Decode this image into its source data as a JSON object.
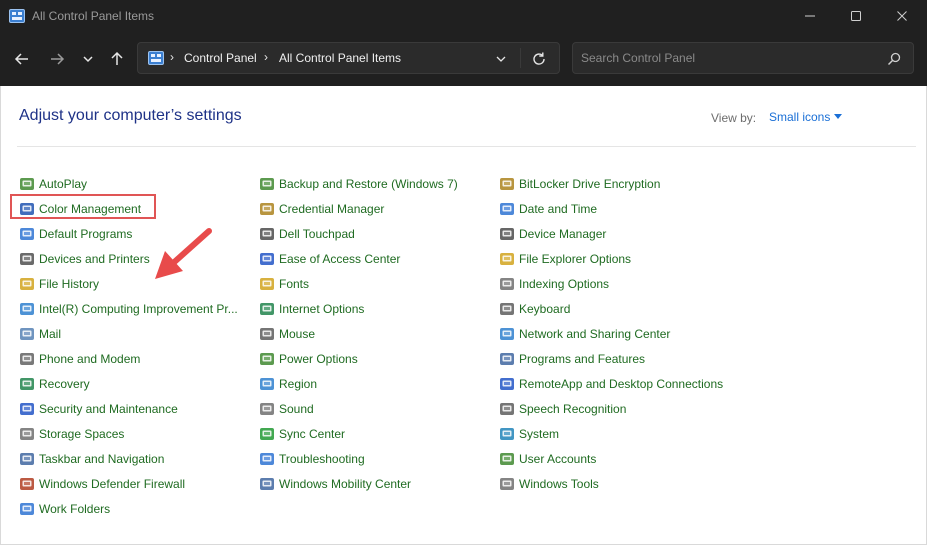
{
  "window": {
    "title": "All Control Panel Items"
  },
  "nav": {
    "breadcrumb": [
      "Control Panel",
      "All Control Panel Items"
    ],
    "search_placeholder": "Search Control Panel"
  },
  "main": {
    "heading": "Adjust your computer’s settings",
    "view_by_label": "View by:",
    "view_by_value": "Small icons"
  },
  "columns": [
    {
      "items": [
        {
          "label": "AutoPlay",
          "icon": "autoplay-icon",
          "color": "#4a8f3c"
        },
        {
          "label": "Color Management",
          "icon": "color-management-icon",
          "color": "#2c5db5"
        },
        {
          "label": "Default Programs",
          "icon": "default-programs-icon",
          "color": "#3a7bd5"
        },
        {
          "label": "Devices and Printers",
          "icon": "devices-printers-icon",
          "color": "#5a5a5a"
        },
        {
          "label": "File History",
          "icon": "file-history-icon",
          "color": "#d4a82a"
        },
        {
          "label": "Intel(R) Computing Improvement Pr...",
          "icon": "intel-icon",
          "color": "#3a86d0"
        },
        {
          "label": "Mail",
          "icon": "mail-icon",
          "color": "#5f88b8"
        },
        {
          "label": "Phone and Modem",
          "icon": "phone-modem-icon",
          "color": "#6a6a6a"
        },
        {
          "label": "Recovery",
          "icon": "recovery-icon",
          "color": "#2e8b57"
        },
        {
          "label": "Security and Maintenance",
          "icon": "flag-icon",
          "color": "#2f5ec9"
        },
        {
          "label": "Storage Spaces",
          "icon": "storage-spaces-icon",
          "color": "#777777"
        },
        {
          "label": "Taskbar and Navigation",
          "icon": "taskbar-icon",
          "color": "#4a6fa5"
        },
        {
          "label": "Windows Defender Firewall",
          "icon": "firewall-icon",
          "color": "#b5482f"
        },
        {
          "label": "Work Folders",
          "icon": "work-folders-icon",
          "color": "#3a7bd5"
        }
      ]
    },
    {
      "items": [
        {
          "label": "Backup and Restore (Windows 7)",
          "icon": "backup-restore-icon",
          "color": "#4a8f3c"
        },
        {
          "label": "Credential Manager",
          "icon": "credential-manager-icon",
          "color": "#b08a2a"
        },
        {
          "label": "Dell Touchpad",
          "icon": "touchpad-icon",
          "color": "#555555"
        },
        {
          "label": "Ease of Access Center",
          "icon": "ease-of-access-icon",
          "color": "#2f5ec9"
        },
        {
          "label": "Fonts",
          "icon": "fonts-icon",
          "color": "#d4a82a"
        },
        {
          "label": "Internet Options",
          "icon": "internet-options-icon",
          "color": "#2e8b57"
        },
        {
          "label": "Mouse",
          "icon": "mouse-icon",
          "color": "#666666"
        },
        {
          "label": "Power Options",
          "icon": "power-options-icon",
          "color": "#4a8f3c"
        },
        {
          "label": "Region",
          "icon": "region-icon",
          "color": "#3a86d0"
        },
        {
          "label": "Sound",
          "icon": "sound-icon",
          "color": "#777777"
        },
        {
          "label": "Sync Center",
          "icon": "sync-center-icon",
          "color": "#2e9e3e"
        },
        {
          "label": "Troubleshooting",
          "icon": "troubleshooting-icon",
          "color": "#3a7bd5"
        },
        {
          "label": "Windows Mobility Center",
          "icon": "mobility-center-icon",
          "color": "#4a6fa5"
        }
      ]
    },
    {
      "items": [
        {
          "label": "BitLocker Drive Encryption",
          "icon": "bitlocker-icon",
          "color": "#b08a2a"
        },
        {
          "label": "Date and Time",
          "icon": "date-time-icon",
          "color": "#3a7bd5"
        },
        {
          "label": "Device Manager",
          "icon": "device-manager-icon",
          "color": "#555555"
        },
        {
          "label": "File Explorer Options",
          "icon": "file-explorer-options-icon",
          "color": "#d4a82a"
        },
        {
          "label": "Indexing Options",
          "icon": "indexing-options-icon",
          "color": "#777777"
        },
        {
          "label": "Keyboard",
          "icon": "keyboard-icon",
          "color": "#666666"
        },
        {
          "label": "Network and Sharing Center",
          "icon": "network-icon",
          "color": "#3a86d0"
        },
        {
          "label": "Programs and Features",
          "icon": "programs-features-icon",
          "color": "#4a6fa5"
        },
        {
          "label": "RemoteApp and Desktop Connections",
          "icon": "remoteapp-icon",
          "color": "#2f5ec9"
        },
        {
          "label": "Speech Recognition",
          "icon": "microphone-icon",
          "color": "#666666"
        },
        {
          "label": "System",
          "icon": "system-icon",
          "color": "#2e8bbd"
        },
        {
          "label": "User Accounts",
          "icon": "user-accounts-icon",
          "color": "#4a8f3c"
        },
        {
          "label": "Windows Tools",
          "icon": "windows-tools-icon",
          "color": "#777777"
        }
      ]
    }
  ],
  "colors": {
    "titlebar": "#202020",
    "item_text": "#1f6b21",
    "heading": "#1e3287",
    "link": "#1a6fd6",
    "annotation": "#e05555"
  }
}
